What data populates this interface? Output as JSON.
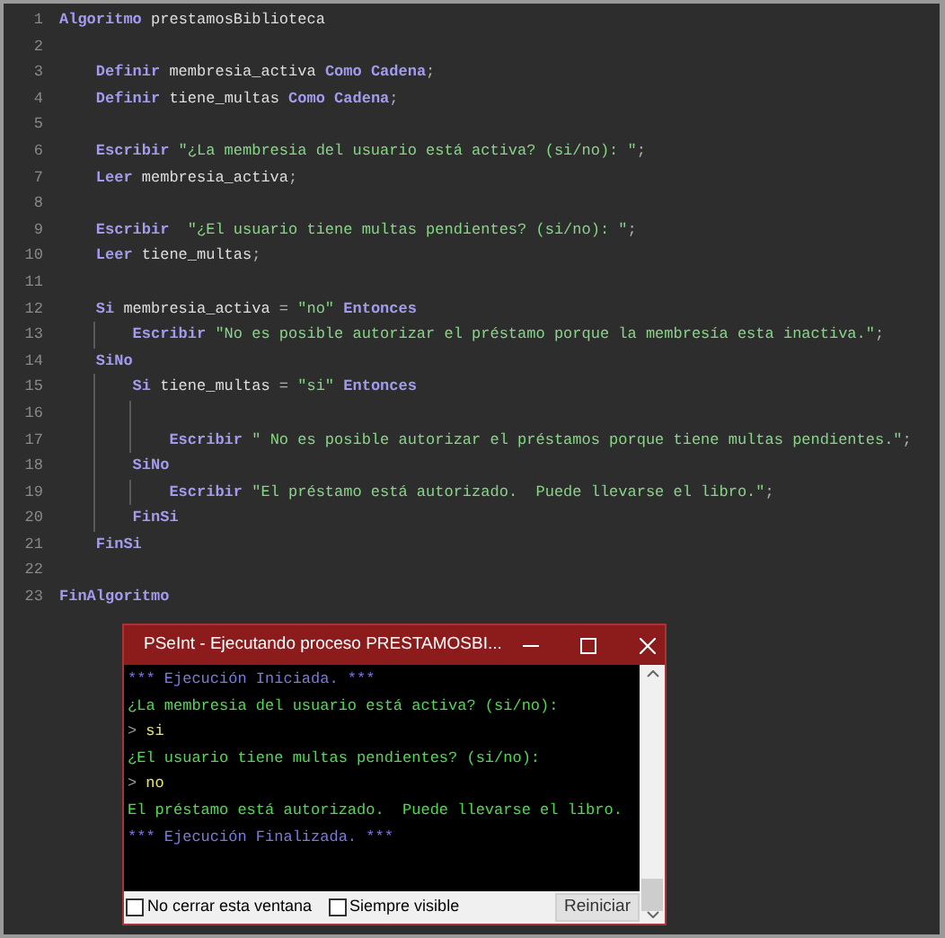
{
  "editor": {
    "lines": [
      {
        "number": "1",
        "tokens": [
          {
            "kind": "kw",
            "text": "Algoritmo"
          },
          {
            "kind": "id",
            "text": " prestamosBiblioteca"
          }
        ],
        "children": [
          {
            "number": "2"
          },
          {
            "number": "3",
            "tokens": [
              {
                "kind": "kw",
                "text": "Definir"
              },
              {
                "kind": "id",
                "text": " membresia_activa "
              },
              {
                "kind": "kw",
                "text": "Como Cadena"
              },
              {
                "kind": "op",
                "text": ";"
              }
            ]
          },
          {
            "number": "4",
            "tokens": [
              {
                "kind": "kw",
                "text": "Definir"
              },
              {
                "kind": "id",
                "text": " tiene_multas "
              },
              {
                "kind": "kw",
                "text": "Como Cadena"
              },
              {
                "kind": "op",
                "text": ";"
              }
            ]
          },
          {
            "number": "5"
          },
          {
            "number": "6",
            "tokens": [
              {
                "kind": "kw",
                "text": "Escribir"
              },
              {
                "kind": "str",
                "text": " \"¿La membresia del usuario está activa? (si/no): \""
              },
              {
                "kind": "op",
                "text": ";"
              }
            ]
          },
          {
            "number": "7",
            "tokens": [
              {
                "kind": "kw",
                "text": "Leer"
              },
              {
                "kind": "id",
                "text": " membresia_activa"
              },
              {
                "kind": "op",
                "text": ";"
              }
            ]
          },
          {
            "number": "8"
          },
          {
            "number": "9",
            "tokens": [
              {
                "kind": "kw",
                "text": "Escribir"
              },
              {
                "kind": "str",
                "text": "  \"¿El usuario tiene multas pendientes? (si/no): \""
              },
              {
                "kind": "op",
                "text": ";"
              }
            ]
          },
          {
            "number": "10",
            "tokens": [
              {
                "kind": "kw",
                "text": "Leer"
              },
              {
                "kind": "id",
                "text": " tiene_multas"
              },
              {
                "kind": "op",
                "text": ";"
              }
            ]
          },
          {
            "number": "11"
          },
          {
            "number": "12",
            "tokens": [
              {
                "kind": "kw",
                "text": "Si"
              },
              {
                "kind": "id",
                "text": " membresia_activa "
              },
              {
                "kind": "op",
                "text": "="
              },
              {
                "kind": "str",
                "text": " \"no\" "
              },
              {
                "kind": "kw",
                "text": "Entonces"
              }
            ],
            "children": [
              {
                "number": "13",
                "tokens": [
                  {
                    "kind": "kw",
                    "text": "Escribir"
                  },
                  {
                    "kind": "str",
                    "text": " \"No es posible autorizar el préstamo porque la membresía esta inactiva.\""
                  },
                  {
                    "kind": "op",
                    "text": ";"
                  }
                ]
              }
            ]
          },
          {
            "number": "14",
            "tokens": [
              {
                "kind": "kw",
                "text": "SiNo"
              }
            ],
            "children": [
              {
                "number": "15",
                "tokens": [
                  {
                    "kind": "kw",
                    "text": "Si"
                  },
                  {
                    "kind": "id",
                    "text": " tiene_multas "
                  },
                  {
                    "kind": "op",
                    "text": "="
                  },
                  {
                    "kind": "str",
                    "text": " \"si\" "
                  },
                  {
                    "kind": "kw",
                    "text": "Entonces"
                  }
                ],
                "children": [
                  {
                    "number": "16"
                  },
                  {
                    "number": "17",
                    "tokens": [
                      {
                        "kind": "kw",
                        "text": "Escribir"
                      },
                      {
                        "kind": "str",
                        "text": " \" No es posible autorizar el préstamos porque tiene multas pendientes.\""
                      },
                      {
                        "kind": "op",
                        "text": ";"
                      }
                    ]
                  }
                ]
              },
              {
                "number": "18",
                "tokens": [
                  {
                    "kind": "kw",
                    "text": "SiNo"
                  }
                ],
                "children": [
                  {
                    "number": "19",
                    "tokens": [
                      {
                        "kind": "kw",
                        "text": "Escribir"
                      },
                      {
                        "kind": "str",
                        "text": " \"El préstamo está autorizado.  Puede llevarse el libro.\""
                      },
                      {
                        "kind": "op",
                        "text": ";"
                      }
                    ]
                  }
                ]
              },
              {
                "number": "20",
                "tokens": [
                  {
                    "kind": "kw",
                    "text": "FinSi"
                  }
                ]
              }
            ]
          },
          {
            "number": "21",
            "tokens": [
              {
                "kind": "kw",
                "text": "FinSi"
              }
            ]
          },
          {
            "number": "22"
          }
        ]
      },
      {
        "number": "23",
        "tokens": [
          {
            "kind": "kw",
            "text": "FinAlgoritmo"
          }
        ]
      }
    ]
  },
  "console": {
    "title": "PSeInt - Ejecutando proceso PRESTAMOSBI...",
    "lines": [
      {
        "kind": "info",
        "text": "*** Ejecución Iniciada. ***"
      },
      {
        "kind": "output",
        "text": "¿La membresia del usuario está activa? (si/no):"
      },
      {
        "kind": "input",
        "marker": ">",
        "text": "si"
      },
      {
        "kind": "output",
        "text": "¿El usuario tiene multas pendientes? (si/no):"
      },
      {
        "kind": "input",
        "marker": ">",
        "text": "no"
      },
      {
        "kind": "output",
        "text": "El préstamo está autorizado.  Puede llevarse el libro."
      },
      {
        "kind": "info",
        "text": "*** Ejecución Finalizada. ***"
      }
    ],
    "options": [
      {
        "label": "No cerrar esta ventana",
        "checked": false
      },
      {
        "label": "Siempre visible",
        "checked": false
      }
    ],
    "button": "Reiniciar"
  }
}
